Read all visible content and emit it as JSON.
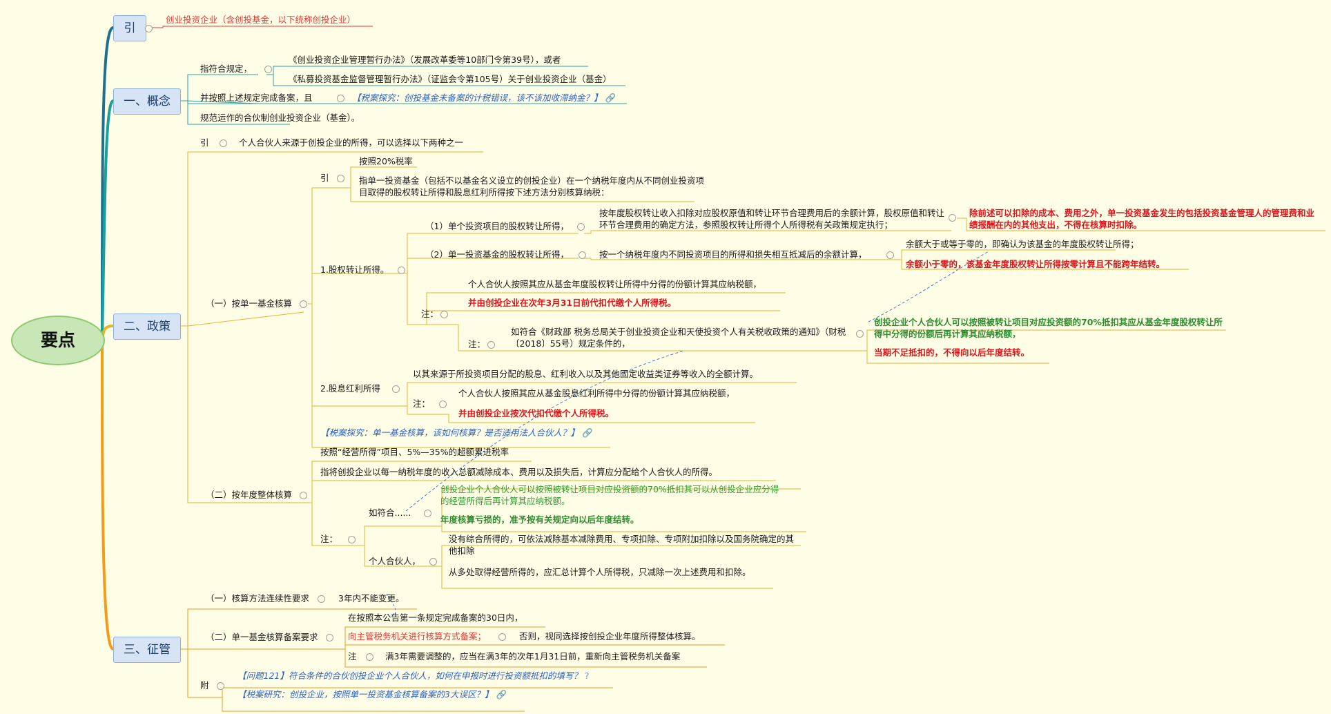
{
  "root": "要点",
  "sec_intro": {
    "label": "引",
    "text": "创业投资企业（含创投基金，以下统称创投企业）"
  },
  "sec_concept": {
    "label": "一、概念",
    "a": "指符合规定，",
    "a1": "《创业投资企业管理暂行办法》（发展改革委等10部门令第39号），或者",
    "a2": "《私募投资基金监督管理暂行办法》（证监会令第105号）关于创业投资企业（基金）",
    "b": "并按照上述规定完成备案，且",
    "b_link": "【税案探究：创投基金未备案的计税错误，该不该加收滞纳金？】",
    "c": "规范运作的合伙制创业投资企业（基金）。"
  },
  "sec_policy": {
    "label": "二、政策",
    "intro_label": "引",
    "intro_text": "个人合伙人来源于创投企业的所得，可以选择以下两种之一",
    "single": {
      "label": "（一）按单一基金核算",
      "yin": "引",
      "yin1": "按照20%税率",
      "yin2": "指单一投资基金（包括不以基金名义设立的创投企业）在一个纳税年度内从不同创业投资项目取得的股权转让所得和股息红利所得按下述方法分别核算纳税：",
      "equity": {
        "label": "1.股权转让所得。",
        "p1": "（1）单个投资项目的股权转让所得，",
        "p1_text": "按年度股权转让收入扣除对应股权原值和转让环节合理费用后的余额计算，股权原值和转让环节合理费用的确定方法，参照股权转让所得个人所得税有关政策规定执行；",
        "p1_note": "除前述可以扣除的成本、费用之外，单一投资基金发生的包括投资基金管理人的管理费和业绩报酬在内的其他支出，不得在核算时扣除。",
        "p2": "（2）单一投资基金的股权转让所得，",
        "p2_text": "按一个纳税年度内不同投资项目的所得和损失相互抵减后的余额计算，",
        "p2_a": "余额大于或等于零的，即确认为该基金的年度股权转让所得；",
        "p2_b": "余额小于零的，该基金年度股权转让所得按零计算且不能跨年结转。",
        "note_label": "注：",
        "note1": "个人合伙人按照其应从基金年度股权转让所得中分得的份额计算其应纳税额，",
        "note2": "并由创投企业在次年3月31日前代扣代缴个人所得税。",
        "note3_label": "注：",
        "note3": "如符合《财政部 税务总局关于创业投资企业和天使投资个人有关税收政策的通知》（财税〔2018〕55号）规定条件的，",
        "note3_a": "创投企业个人合伙人可以按照被转让项目对应投资额的70%抵扣其应从基金年度股权转让所得中分得的份额后再计算其应纳税额，",
        "note3_b": "当期不足抵扣的，不得向以后年度结转。"
      },
      "dividend": {
        "label": "2.股息红利所得",
        "text": "以其来源于所投资项目分配的股息、红利收入以及其他固定收益类证券等收入的全额计算。",
        "note_label": "注：",
        "note1": "个人合伙人按照其应从基金股息红利所得中分得的份额计算其应纳税额，",
        "note2": "并由创投企业按次代扣代缴个人所得税。"
      },
      "link": "【税案探究：单一基金核算，该如何核算？是否适用法人合伙人？】"
    },
    "annual": {
      "label": "（二）按年度整体核算",
      "t1": "按照“经营所得”项目、5%—35%的超额累进税率",
      "t2": "指将创投企业以每一纳税年度的收入总额减除成本、费用以及损失后，计算应分配给个人合伙人的所得。",
      "note_label": "注：",
      "ifmatch": "如符合......",
      "ifmatch_a": "创投企业个人合伙人可以按照被转让项目对应投资额的70%抵扣其可以从创投企业应分得的经营所得后再计算其应纳税额。",
      "ifmatch_b": "年度核算亏损的，准予按有关规定向以后年度结转。",
      "person": "个人合伙人，",
      "person_a": "没有综合所得的，可依法减除基本减除费用、专项扣除、专项附加扣除以及国务院确定的其他扣除",
      "person_b": "从多处取得经营所得的，应汇总计算个人所得税，只减除一次上述费用和扣除。"
    }
  },
  "sec_admin": {
    "label": "三、征管",
    "r1": "（一）核算方法连续性要求",
    "r1_text": "3年内不能变更。",
    "r2": "（二）单一基金核算备案要求",
    "r2_a": "在按照本公告第一条规定完成备案的30日内，",
    "r2_b": "向主管税务机关进行核算方式备案；",
    "r2_b2": "否则，视同选择按创投企业年度所得整体核算。",
    "r2_c_label": "注",
    "r2_c": "满3年需要调整的，应当在满3年的次年1月31日前，重新向主管税务机关备案",
    "fu": "附",
    "fu1": "【问题121】符合条件的合伙创投企业个人合伙人，如何在申报时进行投资额抵扣的填写？",
    "fu2": "【税案研究：创投企业，按照单一投资基金核算备案的3大误区？】"
  }
}
